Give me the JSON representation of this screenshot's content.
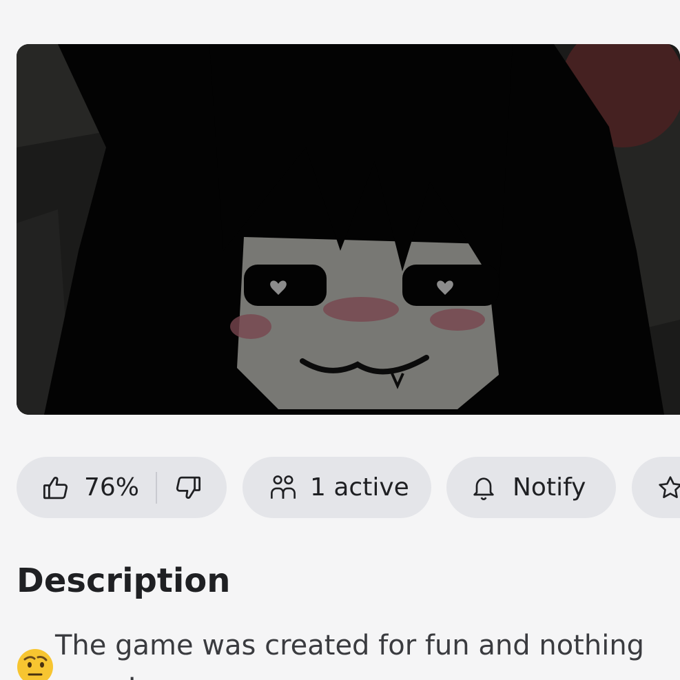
{
  "stats": {
    "like_percent": "76%",
    "active": "1 active",
    "notify": "Notify"
  },
  "description": {
    "title": "Description",
    "text": "The game was created for fun and nothing more!"
  },
  "icons": {
    "like": "thumbs-up-icon",
    "dislike": "thumbs-down-icon",
    "players": "people-icon",
    "notify": "bell-icon",
    "favorite": "star-icon",
    "emoji": "raised-eyebrow-emoji"
  },
  "colors": {
    "background": "#f5f5f6",
    "pill": "#e4e5e9",
    "text": "#1f2023"
  }
}
